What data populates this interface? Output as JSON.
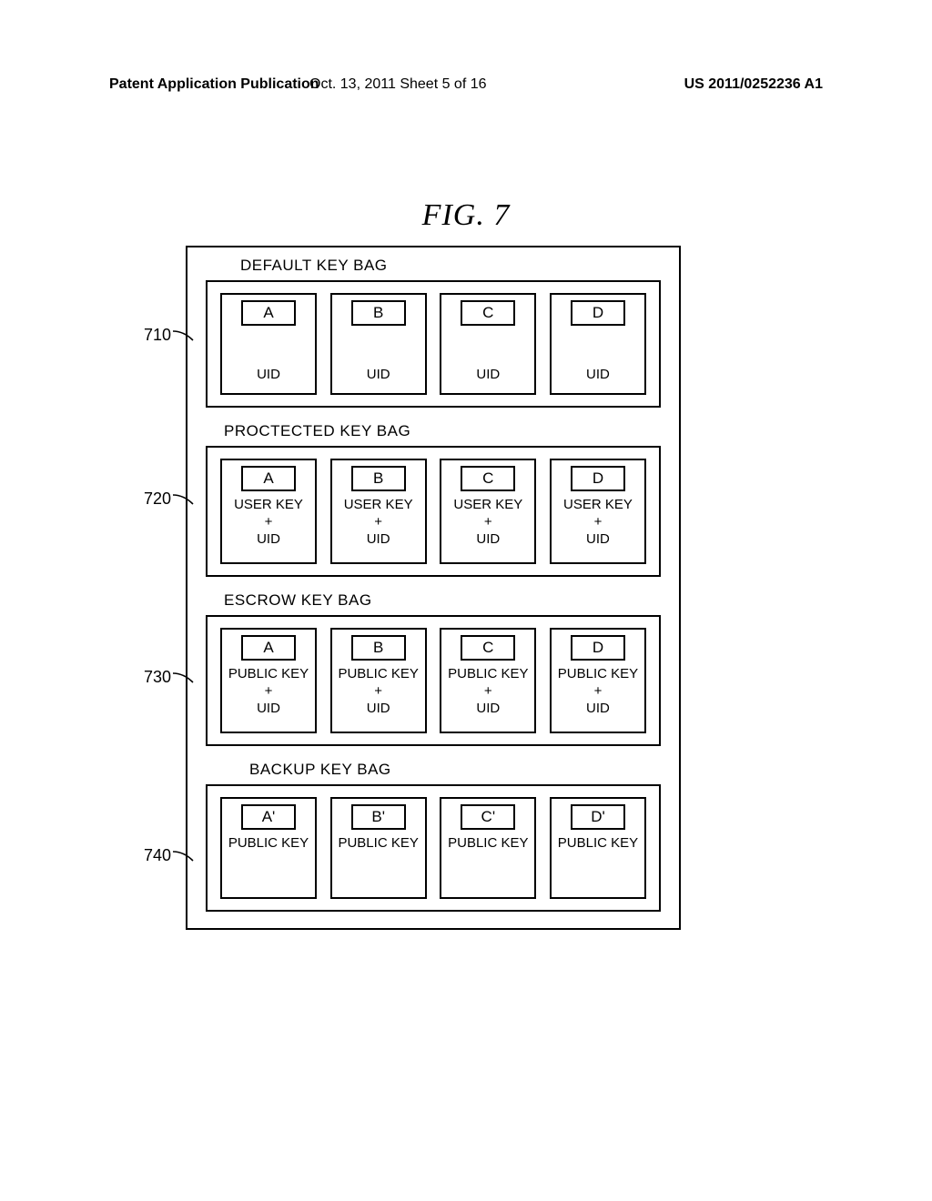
{
  "header": {
    "left": "Patent Application Publication",
    "mid": "Oct. 13, 2011  Sheet 5 of 16",
    "right": "US 2011/0252236 A1"
  },
  "figure_title": "FIG. 7",
  "refs": {
    "r710": "710",
    "r720": "720",
    "r730": "730",
    "r740": "740"
  },
  "bags": {
    "default": {
      "title": "DEFAULT KEY BAG",
      "cells": [
        {
          "key": "A",
          "sub": "UID"
        },
        {
          "key": "B",
          "sub": "UID"
        },
        {
          "key": "C",
          "sub": "UID"
        },
        {
          "key": "D",
          "sub": "UID"
        }
      ]
    },
    "protected": {
      "title": "PROCTECTED KEY BAG",
      "cells": [
        {
          "key": "A",
          "sub": "USER KEY\n+\nUID"
        },
        {
          "key": "B",
          "sub": "USER KEY\n+\nUID"
        },
        {
          "key": "C",
          "sub": "USER KEY\n+\nUID"
        },
        {
          "key": "D",
          "sub": "USER KEY\n+\nUID"
        }
      ]
    },
    "escrow": {
      "title": "ESCROW KEY BAG",
      "cells": [
        {
          "key": "A",
          "sub": "PUBLIC KEY\n+\nUID"
        },
        {
          "key": "B",
          "sub": "PUBLIC KEY\n+\nUID"
        },
        {
          "key": "C",
          "sub": "PUBLIC KEY\n+\nUID"
        },
        {
          "key": "D",
          "sub": "PUBLIC KEY\n+\nUID"
        }
      ]
    },
    "backup": {
      "title": "BACKUP KEY BAG",
      "cells": [
        {
          "key": "A'",
          "sub": "PUBLIC KEY"
        },
        {
          "key": "B'",
          "sub": "PUBLIC KEY"
        },
        {
          "key": "C'",
          "sub": "PUBLIC KEY"
        },
        {
          "key": "D'",
          "sub": "PUBLIC KEY"
        }
      ]
    }
  }
}
